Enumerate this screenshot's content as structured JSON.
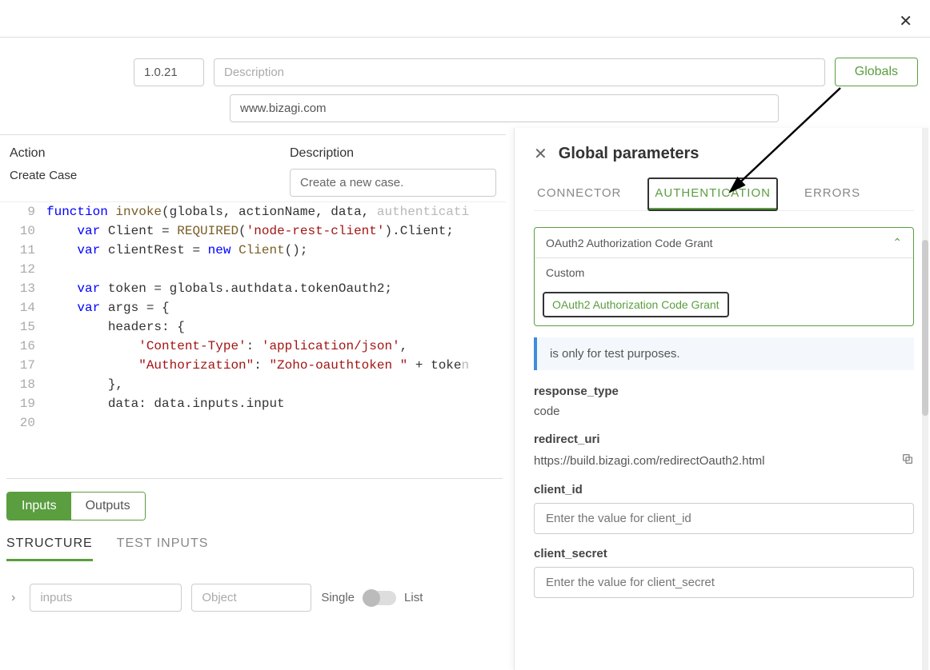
{
  "header": {
    "version": "1.0.21",
    "description_placeholder": "Description",
    "url": "www.bizagi.com",
    "globals_button": "Globals"
  },
  "action_section": {
    "action_label": "Action",
    "action_value": "Create Case",
    "description_label": "Description",
    "description_value": "Create a new case."
  },
  "code": {
    "lines": [
      {
        "n": 9,
        "html": "<span class='kw'>function</span> <span class='fn'>invoke</span>(globals, actionName, data, <span class='faded'>authenticati</span>"
      },
      {
        "n": 10,
        "html": "    <span class='kw'>var</span> Client = <span class='fn'>REQUIRED</span>(<span class='str'>'node-rest-client'</span>).Client;"
      },
      {
        "n": 11,
        "html": "    <span class='kw'>var</span> clientRest = <span class='kw'>new</span> <span class='fn'>Client</span>();"
      },
      {
        "n": 12,
        "html": ""
      },
      {
        "n": 13,
        "html": "    <span class='kw'>var</span> token = globals.authdata.tokenOauth2;"
      },
      {
        "n": 14,
        "html": "    <span class='kw'>var</span> args = {"
      },
      {
        "n": 15,
        "html": "        headers: {"
      },
      {
        "n": 16,
        "html": "            <span class='str'>'Content-Type'</span>: <span class='str'>'application/json'</span>,"
      },
      {
        "n": 17,
        "html": "            <span class='str'>\"Authorization\"</span>: <span class='str'>\"Zoho-oauthtoken \"</span> + toke<span class='faded'>n</span>"
      },
      {
        "n": 18,
        "html": "        },"
      },
      {
        "n": 19,
        "html": "        data: data.inputs.input"
      },
      {
        "n": 20,
        "html": ""
      }
    ]
  },
  "bottom": {
    "tab_inputs": "Inputs",
    "tab_outputs": "Outputs",
    "subtab_structure": "STRUCTURE",
    "subtab_test": "TEST INPUTS",
    "inputs_placeholder": "inputs",
    "type_placeholder": "Object",
    "toggle_single": "Single",
    "toggle_list": "List"
  },
  "panel": {
    "title": "Global parameters",
    "tab_connector": "CONNECTOR",
    "tab_auth": "AUTHENTICATION",
    "tab_errors": "ERRORS",
    "dropdown_selected": "OAuth2 Authorization Code Grant",
    "dropdown_opt_custom": "Custom",
    "dropdown_opt_oauth": "OAuth2 Authorization Code Grant",
    "info_text": "is only for test purposes.",
    "params": {
      "response_type_label": "response_type",
      "response_type_value": "code",
      "redirect_uri_label": "redirect_uri",
      "redirect_uri_value": "https://build.bizagi.com/redirectOauth2.html",
      "client_id_label": "client_id",
      "client_id_placeholder": "Enter the value for client_id",
      "client_secret_label": "client_secret",
      "client_secret_placeholder": "Enter the value for client_secret"
    }
  }
}
